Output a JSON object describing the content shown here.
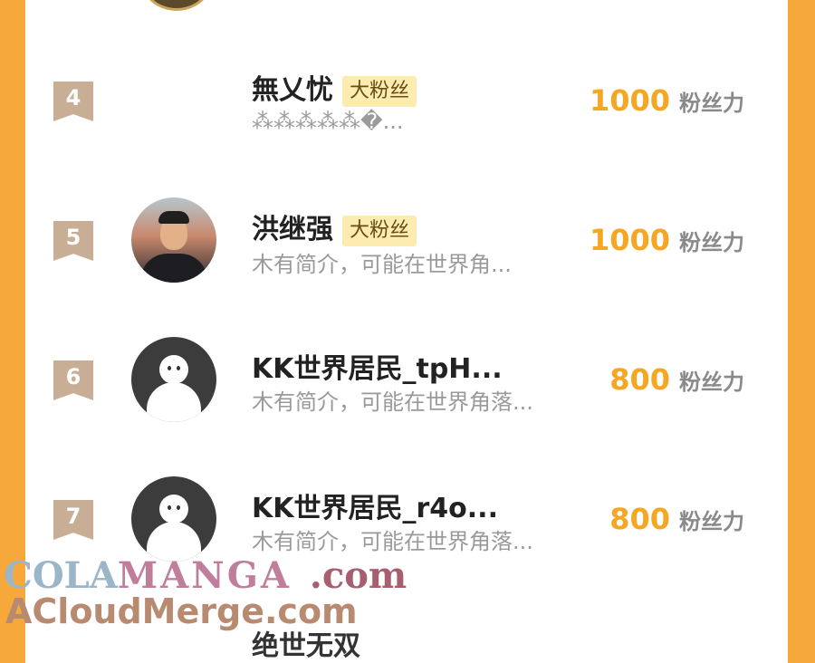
{
  "rows": [
    {
      "rank": "4",
      "name": "無乂忧",
      "badge": "大粉丝",
      "desc": "⁂⁂⁂⁂⁂�...",
      "fans": "1000",
      "unit": "粉丝力",
      "avatar": "none"
    },
    {
      "rank": "5",
      "name": "洪继强",
      "badge": "大粉丝",
      "desc": "木有简介，可能在世界角...",
      "fans": "1000",
      "unit": "粉丝力",
      "avatar": "photo"
    },
    {
      "rank": "6",
      "name": "KK世界居民_tpH...",
      "badge": "",
      "desc": "木有简介，可能在世界角落...",
      "fans": "800",
      "unit": "粉丝力",
      "avatar": "default"
    },
    {
      "rank": "7",
      "name": "KK世界居民_r4o...",
      "badge": "",
      "desc": "木有简介，可能在世界角落...",
      "fans": "800",
      "unit": "粉丝力",
      "avatar": "default"
    }
  ],
  "watermark": {
    "line1_a": "COLA",
    "line1_b": "MANGA",
    "line1_c": ".com",
    "line2": "ACloudMerge.com"
  },
  "next_name": "绝世无双",
  "colors": {
    "accent": "#f5a623",
    "rank_badge": "#c9ae96",
    "fan_badge": "#fcecb0",
    "side": "#f7a83a"
  }
}
